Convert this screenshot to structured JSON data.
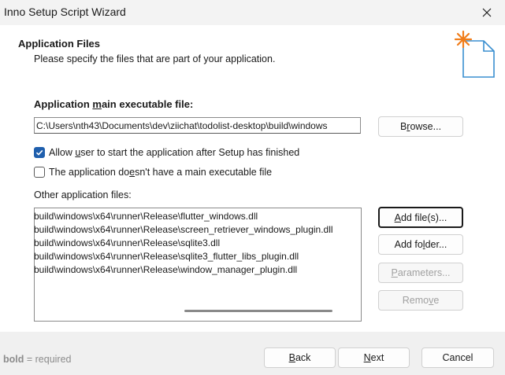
{
  "window": {
    "title": "Inno Setup Script Wizard"
  },
  "header": {
    "title": "Application Files",
    "subtitle": "Please specify the files that are part of your application.",
    "icon": "setup-wizard-document-icon"
  },
  "main_exe": {
    "label_pre": "Application ",
    "label_acc": "m",
    "label_post": "ain executable file:",
    "value": "C:\\Users\\nth43\\Documents\\dev\\ziichat\\todolist-desktop\\build\\windows",
    "browse_pre": "B",
    "browse_acc": "r",
    "browse_post": "owse..."
  },
  "options": {
    "allow_run": {
      "pre": "Allow ",
      "acc": "u",
      "post": "ser to start the application after Setup has finished",
      "checked": true
    },
    "no_main_exe": {
      "pre": "The application do",
      "acc": "e",
      "post": "sn't have a main executable file",
      "checked": false
    }
  },
  "other_files": {
    "label": "Other application files:",
    "items": [
      "build\\windows\\x64\\runner\\Release\\flutter_windows.dll",
      "build\\windows\\x64\\runner\\Release\\screen_retriever_windows_plugin.dll",
      "build\\windows\\x64\\runner\\Release\\sqlite3.dll",
      "build\\windows\\x64\\runner\\Release\\sqlite3_flutter_libs_plugin.dll",
      "build\\windows\\x64\\runner\\Release\\window_manager_plugin.dll"
    ],
    "add_files": {
      "pre": "",
      "acc": "A",
      "post": "dd file(s)..."
    },
    "add_folder": {
      "pre": "Add fo",
      "acc": "l",
      "post": "der..."
    },
    "parameters": {
      "pre": "",
      "acc": "P",
      "post": "arameters..."
    },
    "remove": {
      "pre": "Remo",
      "acc": "v",
      "post": "e"
    }
  },
  "footer": {
    "legend_bold": "bold",
    "legend_text": " = required",
    "back": {
      "pre": "",
      "acc": "B",
      "post": "ack"
    },
    "next": {
      "pre": "",
      "acc": "N",
      "post": "ext"
    },
    "cancel": "Cancel"
  },
  "colors": {
    "accent": "#1f5fad",
    "icon_star": "#f07d1a",
    "icon_doc": "#3a8fd0"
  }
}
